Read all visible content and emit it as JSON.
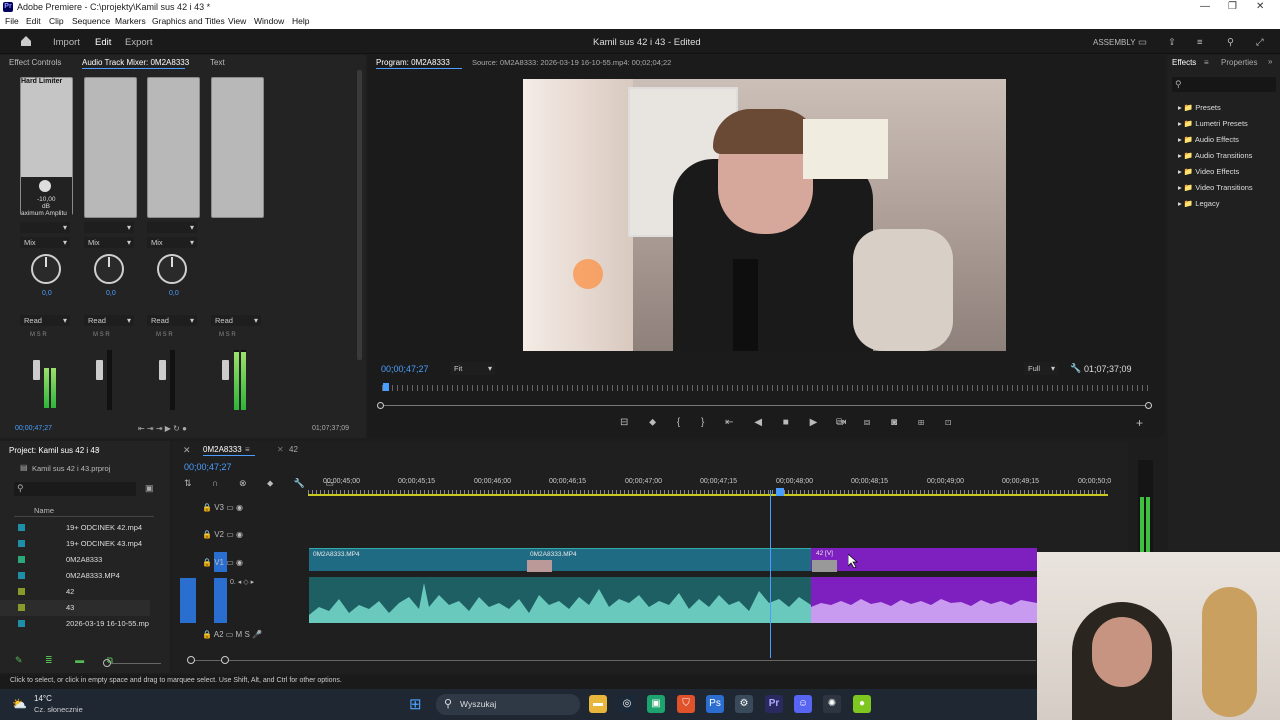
{
  "app": {
    "title": "Adobe Premiere - C:\\projekty\\Kamil sus 42 i 43 *",
    "logo": "Pr"
  },
  "menu": [
    "File",
    "Edit",
    "Clip",
    "Sequence",
    "Markers",
    "Graphics and Titles",
    "View",
    "Window",
    "Help"
  ],
  "header": {
    "import": "Import",
    "edit": "Edit",
    "export": "Export",
    "project_status": "Kamil sus 42 i 43 - Edited",
    "workspace": "ASSEMBLY"
  },
  "left_panel": {
    "tabs": [
      "Effect Controls",
      "Audio Track Mixer: 0M2A8333",
      "Text"
    ],
    "hard_limiter": "Hard Limiter",
    "limiter_db": "-10,00",
    "limiter_unit": "dB",
    "limiter_param": "aximum Amplitu",
    "mix_label": "Mix",
    "pan_value": "0,0",
    "read_label": "Read",
    "msr": "M  S  R",
    "timecode_left": "00;00;47;27",
    "timecode_right": "01;07;37;09"
  },
  "program": {
    "tab": "Program: 0M2A8333",
    "source": "Source: 0M2A8333: 2026-03-19 16-10-55.mp4: 00;02;04;22",
    "timecode": "00;00;47;27",
    "fit": "Fit",
    "quality": "Full",
    "duration": "01;07;37;09"
  },
  "effects": {
    "tab_effects": "Effects",
    "tab_properties": "Properties",
    "items": [
      "Presets",
      "Lumetri Presets",
      "Audio Effects",
      "Audio Transitions",
      "Video Effects",
      "Video Transitions",
      "Legacy"
    ]
  },
  "project": {
    "title": "Project: Kamil sus 42 i 43",
    "file": "Kamil sus 42 i 43.prproj",
    "column_name": "Name",
    "items": [
      {
        "name": "19+ ODCINEK 42.mp4",
        "color": "#1d8fa8"
      },
      {
        "name": "19+ ODCINEK 43.mp4",
        "color": "#1d8fa8"
      },
      {
        "name": "0M2A8333",
        "color": "#2aa87a"
      },
      {
        "name": "0M2A8333.MP4",
        "color": "#1d8fa8"
      },
      {
        "name": "42",
        "color": "#8a9a2a"
      },
      {
        "name": "43",
        "color": "#8a9a2a"
      },
      {
        "name": "2026-03-19 16-10-55.mp",
        "color": "#1d8fa8"
      }
    ]
  },
  "timeline": {
    "seq_tab": "0M2A8333",
    "seq_tab2": "42",
    "timecode": "00;00;47;27",
    "ticks": [
      "00;00;45;00",
      "00;00;45;15",
      "00;00;46;00",
      "00;00;46;15",
      "00;00;47;00",
      "00;00;47;15",
      "00;00;48;00",
      "00;00;48;15",
      "00;00;49;00",
      "00;00;49;15",
      "00;00;50;0"
    ],
    "tracks": [
      "V3",
      "V2",
      "V1",
      "A1",
      "A2"
    ],
    "clip1": "0M2A8333.MP4",
    "clip2": "0M2A8333.MP4",
    "clip3": "42 [V]"
  },
  "status_bar": "Click to select, or click in empty space and drag to marquee select. Use Shift, Alt, and Ctrl for other options.",
  "taskbar": {
    "weather_temp": "14°C",
    "weather_desc": "Cz. słonecznie",
    "search": "Wyszukaj"
  }
}
